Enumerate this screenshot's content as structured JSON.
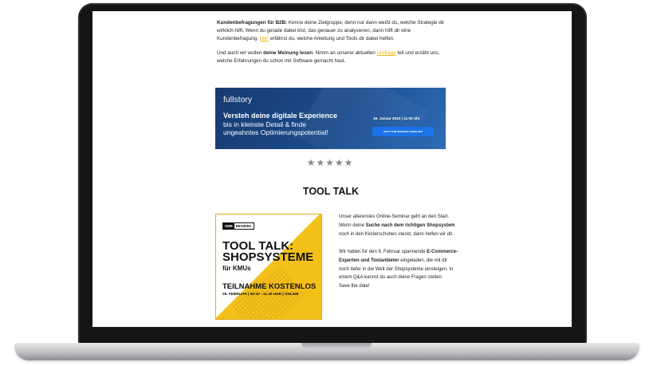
{
  "email": {
    "para1_bold": "Kundenbefragungen für B2B:",
    "para1_text_a": " Kenne deine Zielgruppe, denn nur dann weißt du, welche Strategie dir wirklich hilft. Wenn du gerade dabei bist, das genauer zu analysieren, dann hilft dir eine Kundenbefragung. ",
    "para1_link": "Hier",
    "para1_text_b": " erfährst du, welche Anleitung und Tools dir dabei helfen.",
    "para2_text_a": "Und auch wir wollen ",
    "para2_bold": "deine Meinung lesen",
    "para2_text_b": ": Nimm an unserer aktuellen ",
    "para2_link": "Umfrage",
    "para2_text_c": " teil und erzähl uns, welche Erfahrungen du schon mit Software gemacht hast."
  },
  "banner": {
    "logo": "fullstory",
    "headline": "Versteh deine digitale Experience",
    "subline1": "bis in kleinste Detail & finde",
    "subline2": "ungeahntes Optimierungspotential!",
    "date": "19. Januar 2023 | 11:00 Uhr",
    "cta": "JETZT ZUM WEBINAR ANMELDEN"
  },
  "rating": {
    "stars": "★★★★★",
    "value": 4.5,
    "max": 5
  },
  "section": {
    "title": "TOOL TALK"
  },
  "promo": {
    "badge_omr": "OMR",
    "badge_reviews": "REVIEWS",
    "title_line1": "TOOL TALK:",
    "title_line2": "SHOPSYSTEME",
    "title_line3": "für KMUs",
    "title_line4": "TEILNAHME KOSTENLOS",
    "title_line5": "09. FEBRUAR | 09:30 - 11:30 UHR | ONLINE"
  },
  "promo_text": {
    "p1_a": "Unser allererstes Online-Seminar geht an den Start. Wenn deine ",
    "p1_bold": "Suche nach dem richtigen Shopsystem",
    "p1_b": " noch in den Kinderschuhen steckt, dann helfen wir dir.",
    "p2_a": "Wir haben für den 9. Februar spannende ",
    "p2_bold": "E-Commerce-Experten und Toolanbieter",
    "p2_b": " eingeladen, die mit dir noch tiefer in die Welt der Shopsysteme einsteigen. In einem Q&A kannst du auch deine Fragen stellen.",
    "p3": "Save the date!"
  },
  "colors": {
    "link": "#f0b90b",
    "banner_bg": "#1c4d8e",
    "banner_cta": "#1a73e8",
    "promo_yellow": "#f3c019"
  }
}
